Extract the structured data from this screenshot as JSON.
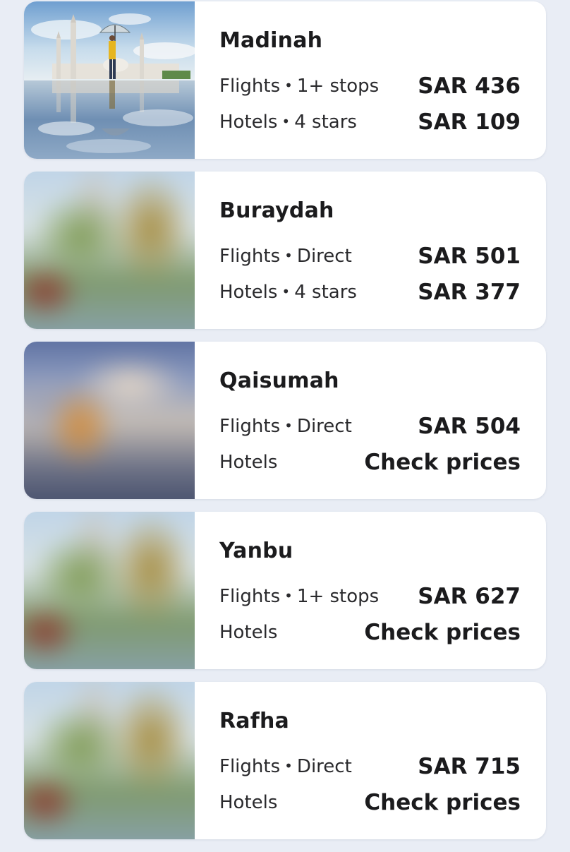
{
  "destinations": [
    {
      "city": "Madinah",
      "flights_label": "Flights",
      "flights_detail": "1+ stops",
      "flights_price": "SAR 436",
      "hotels_label": "Hotels",
      "hotels_detail": "4 stars",
      "hotels_price": "SAR 109",
      "image": "mosque-reflection-photo"
    },
    {
      "city": "Buraydah",
      "flights_label": "Flights",
      "flights_detail": "Direct",
      "flights_price": "SAR 501",
      "hotels_label": "Hotels",
      "hotels_detail": "4 stars",
      "hotels_price": "SAR 377",
      "image": "blurred-city-photo"
    },
    {
      "city": "Qaisumah",
      "flights_label": "Flights",
      "flights_detail": "Direct",
      "flights_price": "SAR 504",
      "hotels_label": "Hotels",
      "hotels_detail": "",
      "hotels_price": "Check prices",
      "image": "blurred-skyline-photo"
    },
    {
      "city": "Yanbu",
      "flights_label": "Flights",
      "flights_detail": "1+ stops",
      "flights_price": "SAR 627",
      "hotels_label": "Hotels",
      "hotels_detail": "",
      "hotels_price": "Check prices",
      "image": "blurred-city-photo"
    },
    {
      "city": "Rafha",
      "flights_label": "Flights",
      "flights_detail": "Direct",
      "flights_price": "SAR 715",
      "hotels_label": "Hotels",
      "hotels_detail": "",
      "hotels_price": "Check prices",
      "image": "blurred-city-photo"
    }
  ]
}
